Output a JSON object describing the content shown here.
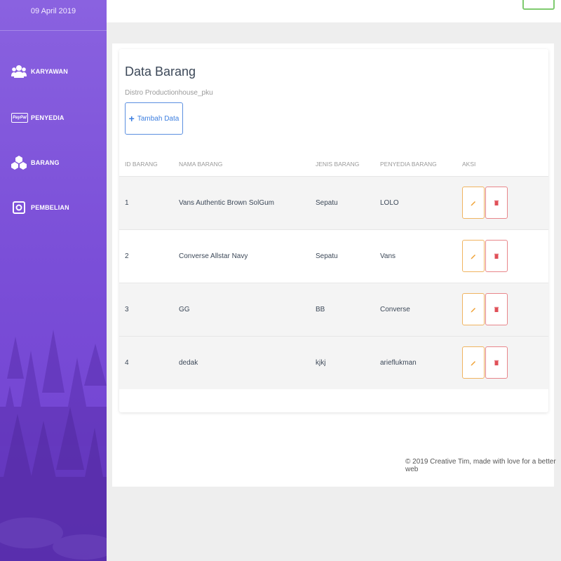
{
  "sidebar": {
    "date": "09 April 2019",
    "items": [
      {
        "label": "KARYAWAN",
        "icon": "users-icon"
      },
      {
        "label": "PENYEDIA",
        "icon": "paypal-icon",
        "icon_text": "PayPal"
      },
      {
        "label": "BARANG",
        "icon": "cubes-icon"
      },
      {
        "label": "PEMBELIAN",
        "icon": "wallet-icon"
      }
    ]
  },
  "card": {
    "title": "Data Barang",
    "subtitle": "Distro Productionhouse_pku",
    "add_button_label": "Tambah Data"
  },
  "table": {
    "headers": [
      "ID BARANG",
      "NAMA BARANG",
      "JENIS BARANG",
      "PENYEDIA BARANG",
      "AKSI"
    ],
    "rows": [
      {
        "id": "1",
        "nama": "Vans Authentic Brown SolGum",
        "jenis": "Sepatu",
        "penyedia": "LOLO"
      },
      {
        "id": "2",
        "nama": "Converse Allstar Navy",
        "jenis": "Sepatu",
        "penyedia": "Vans"
      },
      {
        "id": "3",
        "nama": "GG",
        "jenis": "BB",
        "penyedia": "Converse"
      },
      {
        "id": "4",
        "nama": "dedak",
        "jenis": "kjkj",
        "penyedia": "arieflukman"
      }
    ]
  },
  "footer": {
    "text": "© 2019 Creative Tim, made with love for a better web"
  },
  "colors": {
    "sidebar_top": "#8a62e0",
    "sidebar_bottom": "#6f3fcf",
    "primary_blue": "#3d7fe0",
    "edit_orange": "#f0b460",
    "delete_red": "#e8868a",
    "topbar_button_green": "#7fcb6f"
  }
}
